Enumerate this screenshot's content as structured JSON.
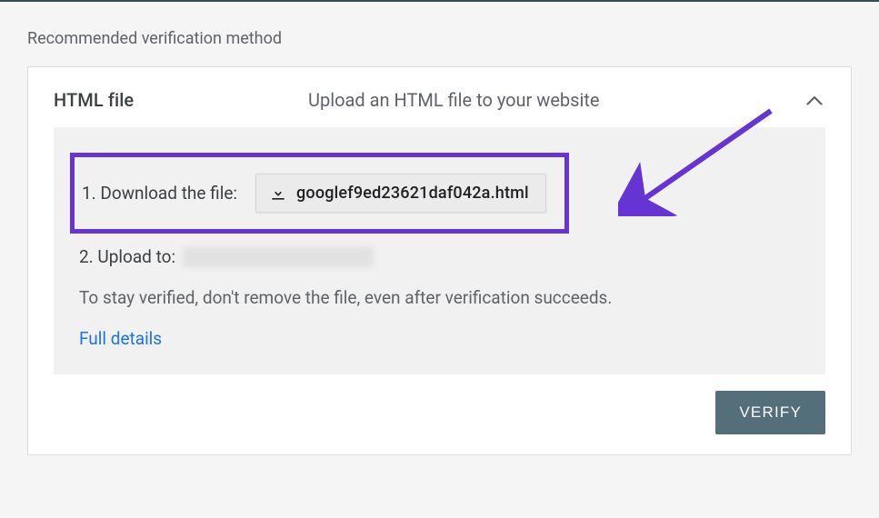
{
  "section_label": "Recommended verification method",
  "card": {
    "title": "HTML file",
    "subtitle": "Upload an HTML file to your website",
    "step1_label": "1. Download the file:",
    "download_filename": "googlef9ed23621daf042a.html",
    "step2_label": "2. Upload to:",
    "note": "To stay verified, don't remove the file, even after verification succeeds.",
    "details_link": "Full details",
    "verify_button": "VERIFY"
  },
  "annotation": {
    "arrow_color": "#6534d3"
  }
}
